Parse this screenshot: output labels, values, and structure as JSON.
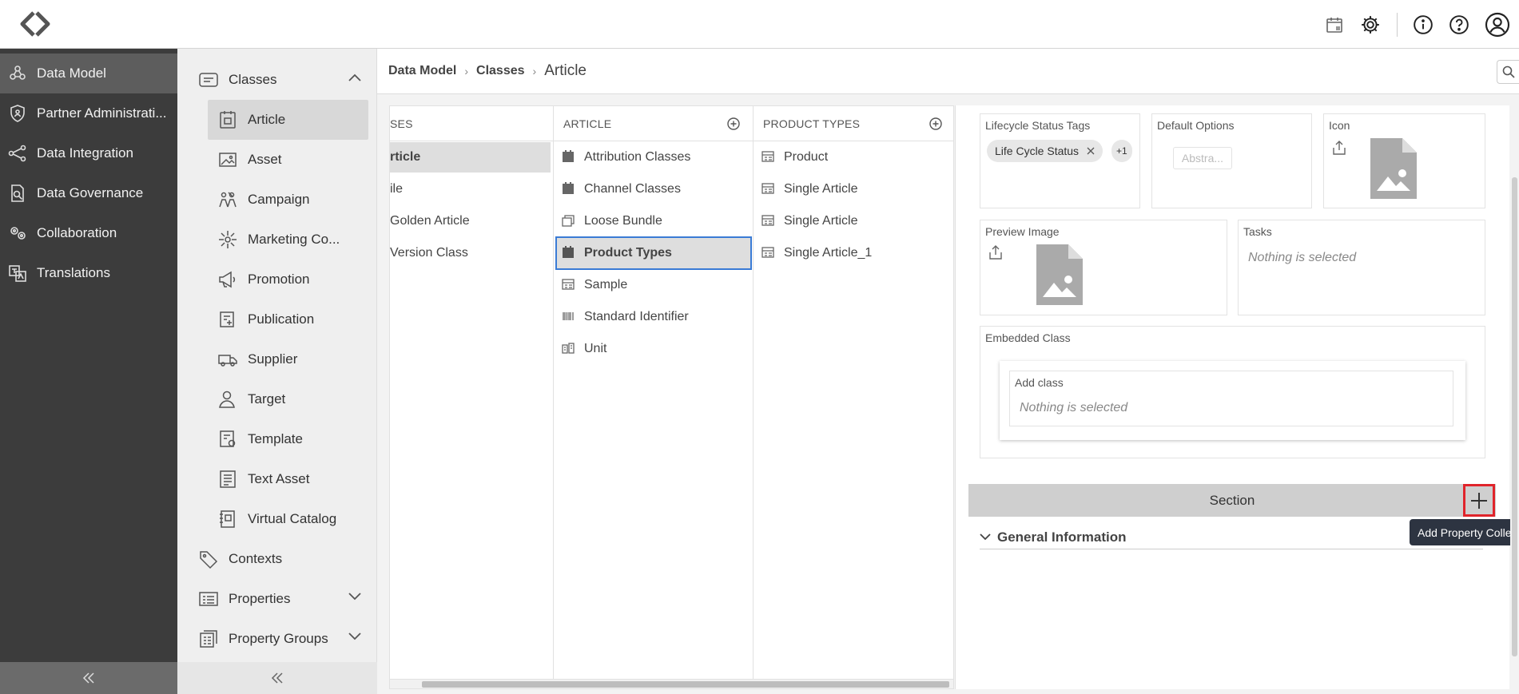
{
  "topbar": {
    "logo": "app-logo-icon",
    "icons": [
      "calendar-badge-icon",
      "gear-icon",
      "info-icon",
      "help-icon",
      "user-avatar-icon"
    ]
  },
  "nav": {
    "items": [
      {
        "label": "Data Model",
        "icon": "data-model-icon",
        "active": true
      },
      {
        "label": "Partner Administrati...",
        "icon": "shield-icon"
      },
      {
        "label": "Data Integration",
        "icon": "integration-icon"
      },
      {
        "label": "Data Governance",
        "icon": "governance-icon"
      },
      {
        "label": "Collaboration",
        "icon": "collaboration-icon"
      },
      {
        "label": "Translations",
        "icon": "translations-icon"
      }
    ]
  },
  "classpanel": {
    "classes_label": "Classes",
    "items": [
      {
        "label": "Article",
        "icon": "article-icon"
      },
      {
        "label": "Asset",
        "icon": "image-icon"
      },
      {
        "label": "Campaign",
        "icon": "campaign-icon"
      },
      {
        "label": "Marketing Co...",
        "icon": "marketing-icon"
      },
      {
        "label": "Promotion",
        "icon": "megaphone-icon"
      },
      {
        "label": "Publication",
        "icon": "publication-icon"
      },
      {
        "label": "Supplier",
        "icon": "truck-icon"
      },
      {
        "label": "Target",
        "icon": "target-icon"
      },
      {
        "label": "Template",
        "icon": "template-icon"
      },
      {
        "label": "Text Asset",
        "icon": "text-asset-icon"
      },
      {
        "label": "Virtual Catalog",
        "icon": "catalog-icon"
      }
    ],
    "contexts_label": "Contexts",
    "properties_label": "Properties",
    "property_groups_label": "Property Groups"
  },
  "breadcrumb": {
    "root": "Data Model",
    "classes": "Classes",
    "current": "Article",
    "sep": "›"
  },
  "columns": {
    "col1": {
      "header": "SES",
      "items": [
        "rticle",
        "ile",
        "Golden Article",
        "Version Class"
      ]
    },
    "col2": {
      "header": "ARTICLE",
      "items": [
        "Attribution Classes",
        "Channel Classes",
        "Loose Bundle",
        "Product Types",
        "Sample",
        "Standard Identifier",
        "Unit"
      ]
    },
    "col3": {
      "header": "PRODUCT TYPES",
      "items": [
        "Product",
        "Single Article",
        "Single Article",
        "Single Article_1"
      ]
    }
  },
  "detail": {
    "lifecycle_label": "Lifecycle Status Tags",
    "lifecycle_chip": "Life Cycle Status",
    "lifecycle_more": "+1",
    "default_options_label": "Default Options",
    "default_options_placeholder": "Abstra...",
    "icon_label": "Icon",
    "preview_label": "Preview Image",
    "tasks_label": "Tasks",
    "tasks_value": "Nothing is selected",
    "embedded_label": "Embedded Class",
    "add_class_label": "Add class",
    "add_class_value": "Nothing is selected",
    "section_label": "Section",
    "tooltip": "Add Property Collec",
    "general_info": "General Information"
  }
}
